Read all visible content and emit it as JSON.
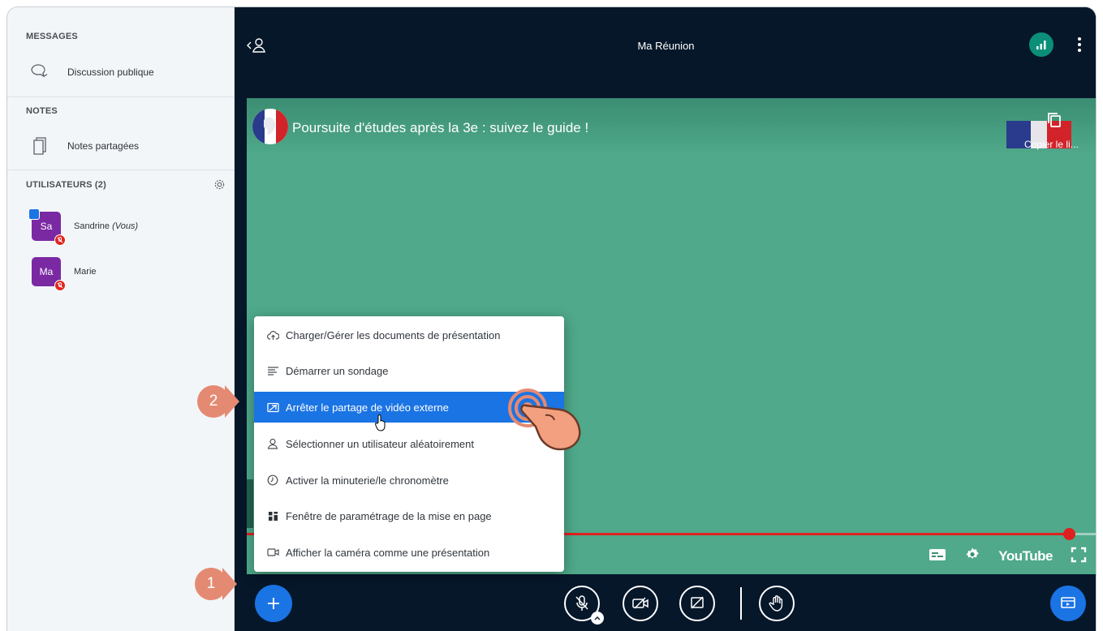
{
  "sidebar": {
    "messages_title": "MESSAGES",
    "public_chat_label": "Discussion publique",
    "notes_title": "NOTES",
    "shared_notes_label": "Notes partagées",
    "users_title": "UTILISATEURS (2)",
    "users": [
      {
        "initials": "Sa",
        "name": "Sandrine",
        "suffix": "(Vous)",
        "presenter": true,
        "muted": true
      },
      {
        "initials": "Ma",
        "name": "Marie",
        "suffix": "",
        "presenter": false,
        "muted": true
      }
    ]
  },
  "header": {
    "meeting_title": "Ma Réunion"
  },
  "video": {
    "title": "Poursuite d'études après la 3e : suivez le guide !",
    "copy_link_label": "Copier le li...",
    "provider": "YouTube",
    "progress": 0.968
  },
  "action_menu": {
    "items": [
      {
        "label": "Charger/Gérer les documents de présentation",
        "icon": "upload-icon"
      },
      {
        "label": "Démarrer un sondage",
        "icon": "poll-icon"
      },
      {
        "label": "Arrêter le partage de vidéo externe",
        "icon": "external-video-icon",
        "active": true
      },
      {
        "label": "Sélectionner un utilisateur aléatoirement",
        "icon": "user-icon"
      },
      {
        "label": "Activer la minuterie/le chronomètre",
        "icon": "timer-icon"
      },
      {
        "label": "Fenêtre de paramétrage de la mise en page",
        "icon": "layout-icon"
      },
      {
        "label": "Afficher la caméra comme une présentation",
        "icon": "camera-icon"
      }
    ]
  },
  "tutorial": {
    "step1": "1",
    "step2": "2"
  },
  "colors": {
    "accent": "#1b74e4",
    "sidebar_bg": "#f3f6f9",
    "topbar_bg": "#06172a",
    "video_bg": "#4fa98a",
    "step_badge": "#e58a72",
    "progress": "#e02020"
  }
}
